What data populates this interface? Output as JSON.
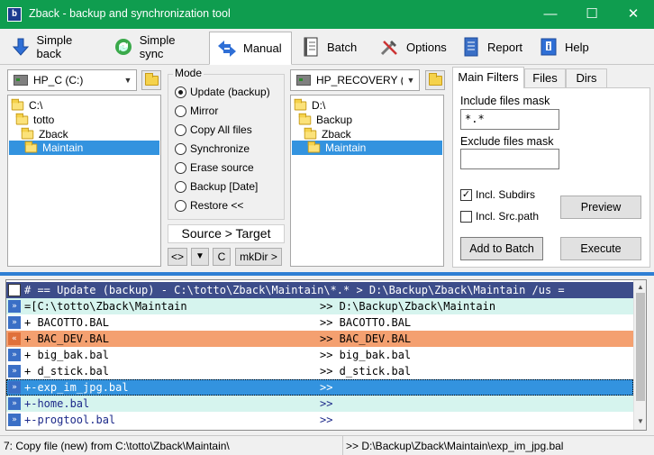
{
  "window": {
    "title": "Zback - backup and synchronization tool",
    "app_icon": "b"
  },
  "tabs": [
    {
      "label": "Simple back",
      "icon": "arrow-down-icon"
    },
    {
      "label": "Simple sync",
      "icon": "sync-icon"
    },
    {
      "label": "Manual",
      "icon": "swap-arrows-icon"
    },
    {
      "label": "Batch",
      "icon": "document-icon"
    },
    {
      "label": "Options",
      "icon": "tools-icon"
    },
    {
      "label": "Report",
      "icon": "report-icon"
    },
    {
      "label": "Help",
      "icon": "help-book-icon"
    }
  ],
  "left": {
    "drive": "HP_C (C:)",
    "tree": [
      {
        "label": "C:\\"
      },
      {
        "label": "totto"
      },
      {
        "label": "Zback"
      },
      {
        "label": "Maintain"
      }
    ]
  },
  "mode": {
    "title": "Mode",
    "options": [
      "Update (backup)",
      "Mirror",
      "Copy All files",
      "Synchronize",
      "Erase source",
      "Backup [Date]",
      "Restore <<"
    ],
    "selected": "Update (backup)",
    "direction_label": "Source > Target",
    "buttons": [
      "<>",
      "▼",
      "C",
      "mkDir >"
    ]
  },
  "right": {
    "drive": "HP_RECOVERY (I",
    "tree": [
      {
        "label": "D:\\"
      },
      {
        "label": "Backup"
      },
      {
        "label": "Zback"
      },
      {
        "label": "Maintain"
      }
    ]
  },
  "filters": {
    "tabs": [
      "Main Filters",
      "Files",
      "Dirs"
    ],
    "include_label": "Include files mask",
    "include_value": "*.*",
    "exclude_label": "Exclude files mask",
    "exclude_value": "",
    "incl_subdirs": "Incl. Subdirs",
    "incl_subdirs_checked": true,
    "incl_srcpath": "Incl. Src.path",
    "incl_srcpath_checked": false,
    "preview": "Preview",
    "add_to_batch": "Add to Batch",
    "execute": "Execute"
  },
  "list": {
    "header": "# == Update (backup) - C:\\totto\\Zback\\Maintain\\*.* >  D:\\Backup\\Zback\\Maintain  /us =",
    "rows": [
      {
        "c1": "=[C:\\totto\\Zback\\Maintain",
        "c2": ">> D:\\Backup\\Zback\\Maintain",
        "style": "dir",
        "icon": "»"
      },
      {
        "c1": "+ BACOTTO.BAL",
        "c2": ">> BACOTTO.BAL",
        "style": "ok",
        "icon": "»"
      },
      {
        "c1": "+ BAC_DEV.BAL",
        "c2": ">> BAC_DEV.BAL",
        "style": "orange",
        "icon": "«"
      },
      {
        "c1": "+ big_bak.bal",
        "c2": ">> big_bak.bal",
        "style": "ok",
        "icon": "»"
      },
      {
        "c1": "+ d_stick.bal",
        "c2": ">> d_stick.bal",
        "style": "ok",
        "icon": "»"
      },
      {
        "c1": "+-exp_im_jpg.bal",
        "c2": ">>",
        "style": "selected",
        "icon": "»"
      },
      {
        "c1": "+-home.bal",
        "c2": ">>",
        "style": "new",
        "icon": "»"
      },
      {
        "c1": "+-progtool.bal",
        "c2": ">>",
        "style": "new",
        "icon": "»"
      }
    ]
  },
  "status": {
    "left": "7: Copy file (new) from C:\\totto\\Zback\\Maintain\\",
    "right": ">> D:\\Backup\\Zback\\Maintain\\exp_im_jpg.bal"
  },
  "colors": {
    "titlebar": "#0f9d4f",
    "selection": "#3393df",
    "orange_row": "#f4a070",
    "header_row": "#3d4d8a"
  }
}
